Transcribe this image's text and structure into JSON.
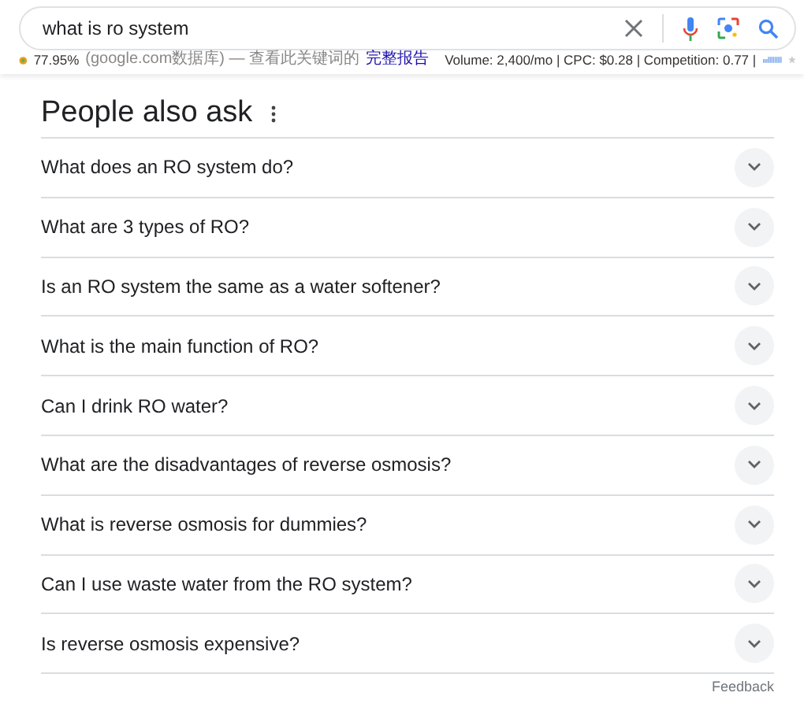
{
  "search": {
    "value": "what is ro system"
  },
  "seo_bar": {
    "score": "77.95%",
    "source": "(google.com数据库) — 查看此关键词的",
    "report_link": "完整报告",
    "metrics": "Volume: 2,400/mo | CPC: $0.28 | Competition: 0.77 |"
  },
  "people_also_ask": {
    "title": "People also ask",
    "questions": [
      {
        "text": "What does an RO system do?",
        "expanded": false
      },
      {
        "text": "What are 3 types of RO?",
        "expanded": false
      },
      {
        "text": "Is an RO system the same as a water softener?",
        "expanded": false
      },
      {
        "text": "What is the main function of RO?",
        "expanded": false
      },
      {
        "text": "Can I drink RO water?",
        "expanded": false
      },
      {
        "text": "What are the disadvantages of reverse osmosis?",
        "expanded": false
      },
      {
        "text": "What is reverse osmosis for dummies?",
        "expanded": false
      },
      {
        "text": "Can I use waste water from the RO system?",
        "expanded": false
      },
      {
        "text": "Is reverse osmosis expensive?",
        "expanded": false
      }
    ],
    "feedback": "Feedback"
  }
}
